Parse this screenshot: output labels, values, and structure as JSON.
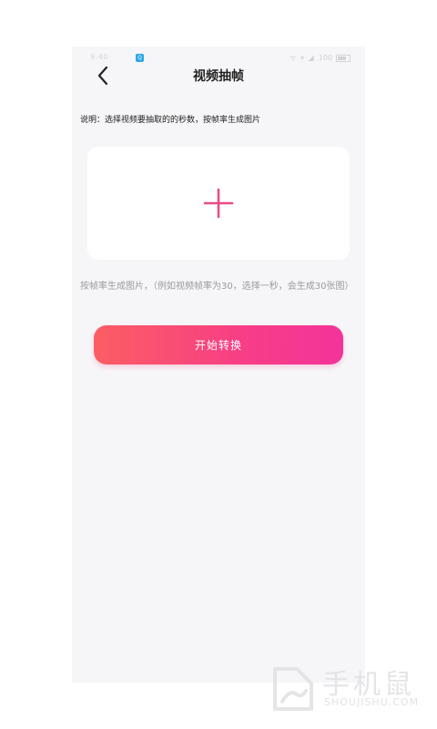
{
  "status_bar": {
    "time": "9:40",
    "indicators": "ᯤ ▾ ◢",
    "battery": "100"
  },
  "header": {
    "back_icon": "chevron-left-icon",
    "title": "视频抽帧"
  },
  "main": {
    "description": "说明：选择视频要抽取的的秒数，按帧率生成图片",
    "upload": {
      "icon": "plus-icon",
      "icon_color": "#e94b86"
    },
    "hint": "按帧率生成图片，（例如视频帧率为30，选择一秒，会生成30张图）",
    "start_button_label": "开始转换"
  },
  "watermark": {
    "name": "手机鼠",
    "url": "SHOUJISHU.COM"
  },
  "colors": {
    "accent_start": "#fb5e63",
    "accent_end": "#f3339a",
    "background": "#f6f6f8"
  }
}
